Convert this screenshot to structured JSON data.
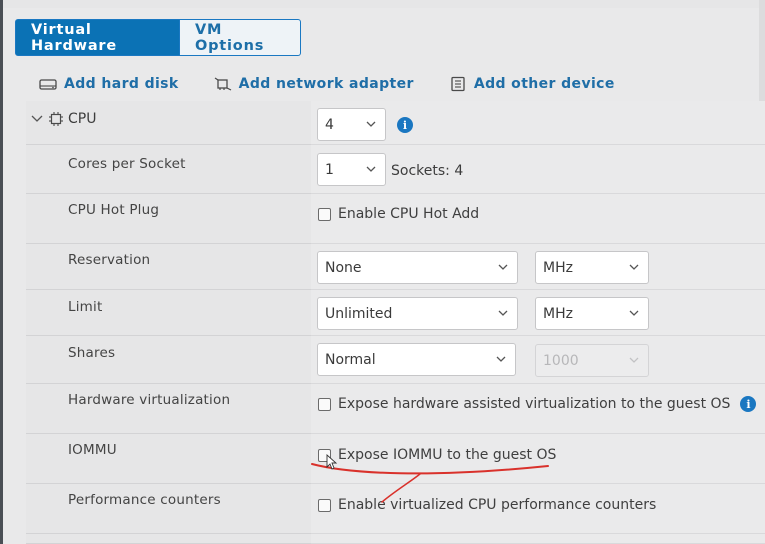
{
  "tabs": [
    {
      "label": "Virtual Hardware",
      "active": true
    },
    {
      "label": "VM Options",
      "active": false
    }
  ],
  "toolbar": {
    "add_hard_disk": "Add hard disk",
    "add_network_adapter": "Add network adapter",
    "add_other_device": "Add other device"
  },
  "cpu": {
    "label": "CPU",
    "value": "4",
    "cores_label": "Cores per Socket",
    "cores_value": "1",
    "sockets_text": "Sockets: 4",
    "hotplug_label": "CPU Hot Plug",
    "hotplug_option": "Enable CPU Hot Add",
    "reservation_label": "Reservation",
    "reservation_value": "None",
    "reservation_unit": "MHz",
    "limit_label": "Limit",
    "limit_value": "Unlimited",
    "limit_unit": "MHz",
    "shares_label": "Shares",
    "shares_value": "Normal",
    "shares_number": "1000",
    "hwvirt_label": "Hardware virtualization",
    "hwvirt_option": "Expose hardware assisted virtualization to the guest OS",
    "iommu_label": "IOMMU",
    "iommu_option": "Expose IOMMU to the guest OS",
    "perf_label": "Performance counters",
    "perf_option": "Enable virtualized CPU performance counters"
  },
  "colors": {
    "accent": "#0b72b5",
    "link": "#1f6ea7",
    "info": "#1a77c1",
    "annotation": "#d9312b"
  },
  "icons": [
    "disk-icon",
    "network-adapter-icon",
    "device-list-icon",
    "collapse-chevron-icon",
    "cpu-chip-icon",
    "info-icon",
    "chevron-down-icon"
  ]
}
